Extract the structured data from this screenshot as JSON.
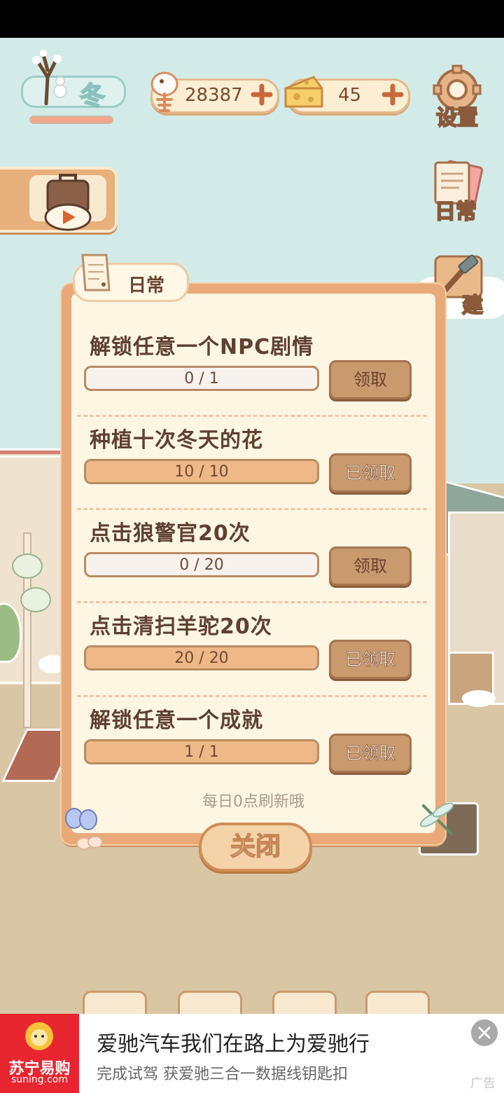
{
  "season": {
    "label": "冬"
  },
  "resources": {
    "fish": "28387",
    "cheese": "45"
  },
  "side_menu": {
    "settings": "设置",
    "daily": "日常",
    "build": "建"
  },
  "daily_panel": {
    "tab_label": "日常",
    "tasks": [
      {
        "title": "解锁任意一个NPC剧情",
        "progress_text": "0 / 1",
        "progress": 0.0,
        "button": "领取"
      },
      {
        "title": "种植十次冬天的花",
        "progress_text": "10 / 10",
        "progress": 1.0,
        "button": "已领取"
      },
      {
        "title": "点击狼警官20次",
        "progress_text": "0 / 20",
        "progress": 0.0,
        "button": "领取"
      },
      {
        "title": "点击清扫羊驼20次",
        "progress_text": "20 / 20",
        "progress": 1.0,
        "button": "已领取"
      },
      {
        "title": "解锁任意一个成就",
        "progress_text": "1 / 1",
        "progress": 1.0,
        "button": "已领取"
      }
    ],
    "refresh_note": "每日0点刷新哦",
    "close_label": "关闭"
  },
  "ad": {
    "logo_cn": "苏宁易购",
    "logo_en": "suning.com",
    "title": "爱驰汽车我们在路上为爱驰行",
    "subtitle": "完成试驾 获爱驰三合一数据线钥匙扣",
    "tag": "广告"
  },
  "colors": {
    "accent": "#e9a978",
    "panel": "#fdf6e3",
    "text": "#5e4031",
    "ad_brand": "#e8262f"
  }
}
